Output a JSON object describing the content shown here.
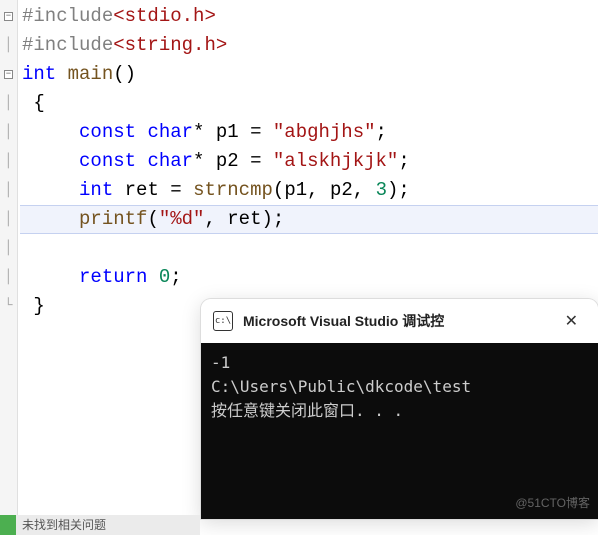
{
  "code": {
    "line1": {
      "pre": "#include",
      "open": "<",
      "header": "stdio.h",
      "close": ">"
    },
    "line2": {
      "pre": "#include",
      "open": "<",
      "header": "string.h",
      "close": ">"
    },
    "line3": {
      "kw1": "int",
      "func": "main",
      "paren": "()"
    },
    "line4": "{",
    "line5": {
      "kw1": "const",
      "kw2": "char",
      "star": "*",
      "var": "p1",
      "eq": "=",
      "str": "\"abghjhs\"",
      "semi": ";"
    },
    "line6": {
      "kw1": "const",
      "kw2": "char",
      "star": "*",
      "var": "p2",
      "eq": "=",
      "str": "\"alskhjkjk\"",
      "semi": ";"
    },
    "line7": {
      "kw1": "int",
      "var": "ret",
      "eq": "=",
      "func": "strncmp",
      "open": "(",
      "a1": "p1",
      "c1": ",",
      "a2": "p2",
      "c2": ",",
      "a3": "3",
      "close": ")",
      "semi": ";"
    },
    "line8": {
      "func": "printf",
      "open": "(",
      "str": "\"%d\"",
      "c1": ",",
      "a2": "ret",
      "close": ")",
      "semi": ";"
    },
    "line10": {
      "kw": "return",
      "val": "0",
      "semi": ";"
    },
    "line11": "}"
  },
  "console": {
    "title": "Microsoft Visual Studio 调试控",
    "lines": {
      "l1": "-1",
      "l2": "C:\\Users\\Public\\dkcode\\test",
      "l3": "按任意键关闭此窗口. . ."
    }
  },
  "watermark": "@51CTO博客",
  "bottom_text": "未找到相关问题"
}
